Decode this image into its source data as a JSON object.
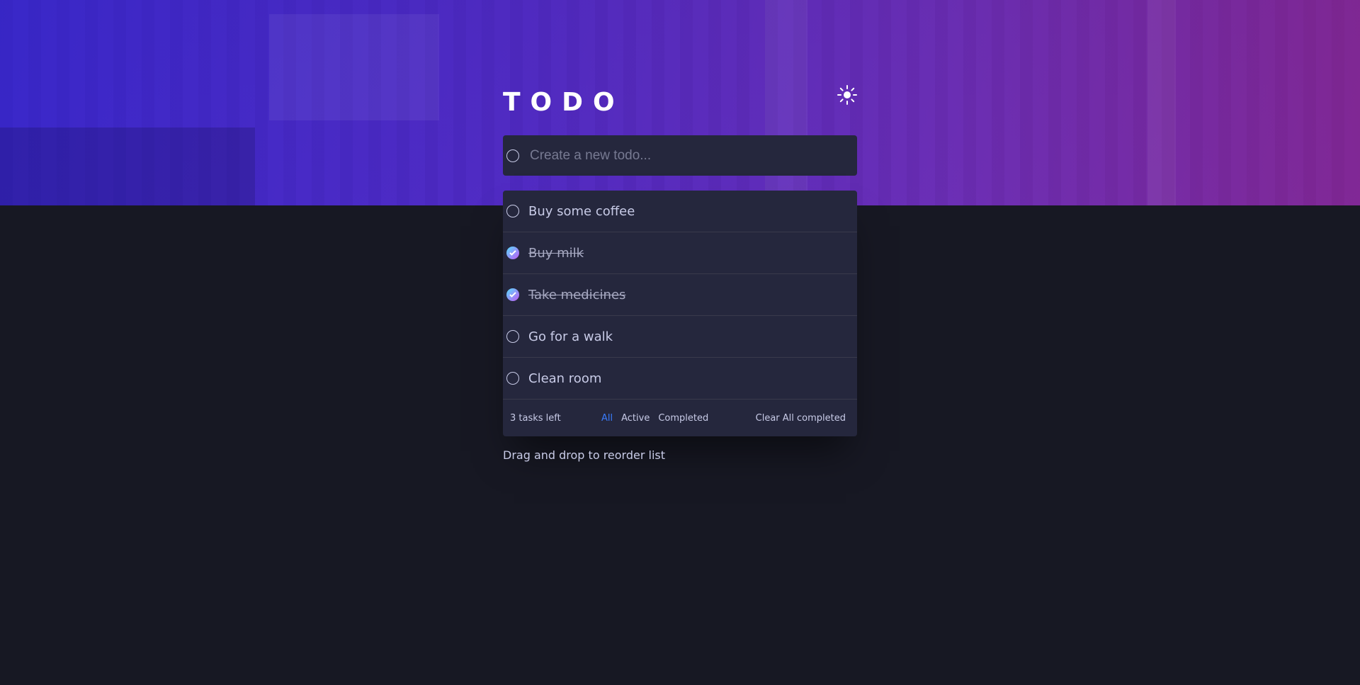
{
  "app": {
    "title": "TODO",
    "theme_icon": "sun-icon"
  },
  "new_todo": {
    "placeholder": "Create a new todo...",
    "value": ""
  },
  "todos": [
    {
      "label": "Buy some coffee",
      "completed": false
    },
    {
      "label": "Buy milk",
      "completed": true
    },
    {
      "label": "Take medicines",
      "completed": true
    },
    {
      "label": "Go for a walk",
      "completed": false
    },
    {
      "label": "Clean room",
      "completed": false
    }
  ],
  "footer": {
    "items_left": "3 tasks left",
    "filters": [
      {
        "label": "All",
        "active": true
      },
      {
        "label": "Active",
        "active": false
      },
      {
        "label": "Completed",
        "active": false
      }
    ],
    "clear_label": "Clear All completed"
  },
  "hint": "Drag and drop to reorder list",
  "colors": {
    "background": "#171823",
    "card": "#25273d",
    "text": "#c8cbe7",
    "active_filter": "#3a7cfd",
    "check_gradient_start": "#57ddff",
    "check_gradient_end": "#c058f3"
  }
}
